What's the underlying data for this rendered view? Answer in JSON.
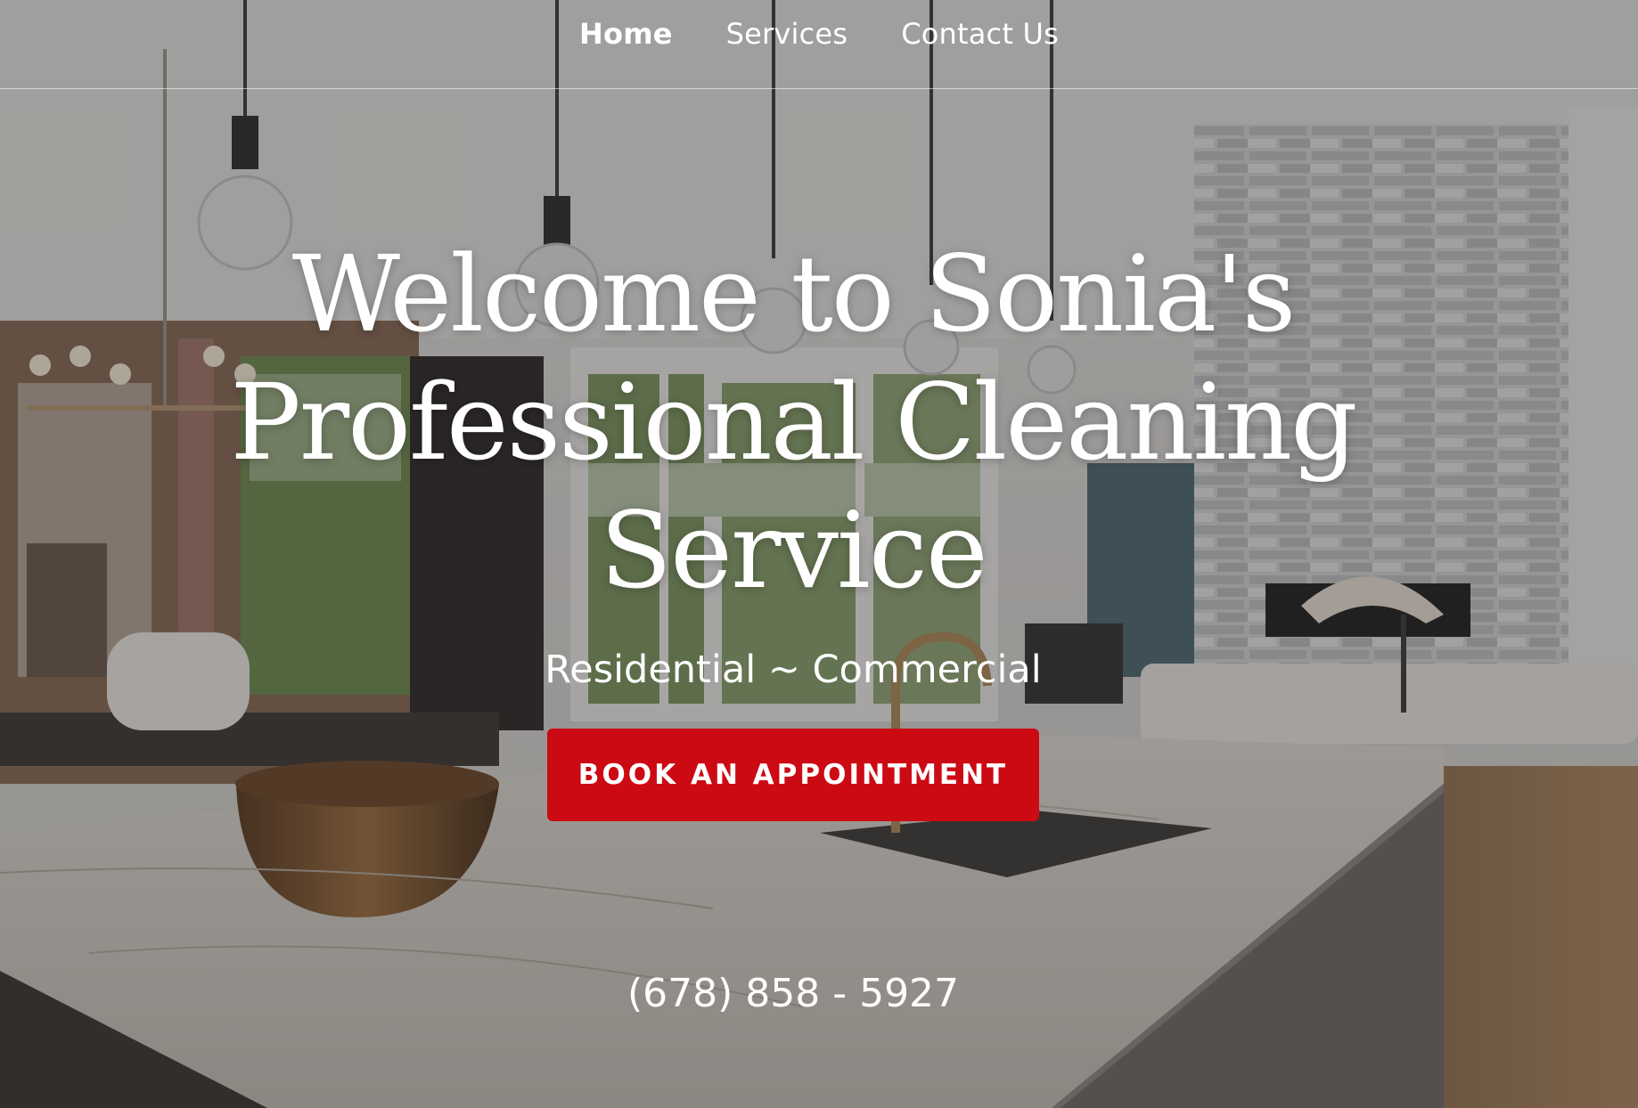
{
  "nav": {
    "items": [
      {
        "label": "Home"
      },
      {
        "label": "Services"
      },
      {
        "label": "Contact Us"
      }
    ]
  },
  "hero": {
    "headline": "Welcome to Sonia's Professional Cleaning Service",
    "tagline": "Residential ~ Commercial",
    "cta_label": "BOOK AN APPOINTMENT",
    "phone": "(678) 858 - 5927"
  },
  "colors": {
    "accent": "#cc0a13",
    "text": "#ffffff",
    "overlay": "#28262499"
  }
}
